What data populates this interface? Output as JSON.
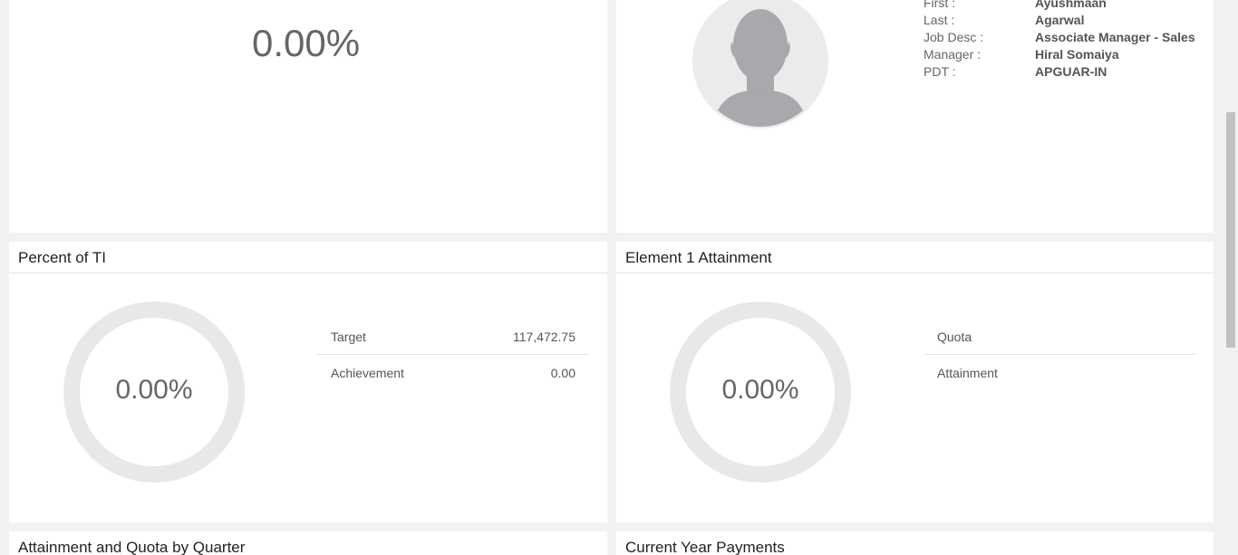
{
  "top_left": {
    "percent": "0.00%"
  },
  "profile": {
    "rows": [
      {
        "label": "First :",
        "value": "Ayushmaan"
      },
      {
        "label": "Last :",
        "value": "Agarwal"
      },
      {
        "label": "Job Desc :",
        "value": "Associate Manager - Sales"
      },
      {
        "label": "Manager :",
        "value": "Hiral Somaiya"
      },
      {
        "label": "PDT :",
        "value": "APGUAR-IN"
      }
    ]
  },
  "percent_of_ti": {
    "title": "Percent of TI",
    "ring_value": "0.00%",
    "rows": [
      {
        "label": "Target",
        "value": "117,472.75"
      },
      {
        "label": "Achievement",
        "value": "0.00"
      }
    ]
  },
  "element_attainment": {
    "title": "Element 1 Attainment",
    "ring_value": "0.00%",
    "rows": [
      {
        "label": "Quota",
        "value": ""
      },
      {
        "label": "Attainment",
        "value": ""
      }
    ]
  },
  "bottom": {
    "left_title": "Attainment and Quota by Quarter",
    "right_title": "Current Year Payments"
  }
}
